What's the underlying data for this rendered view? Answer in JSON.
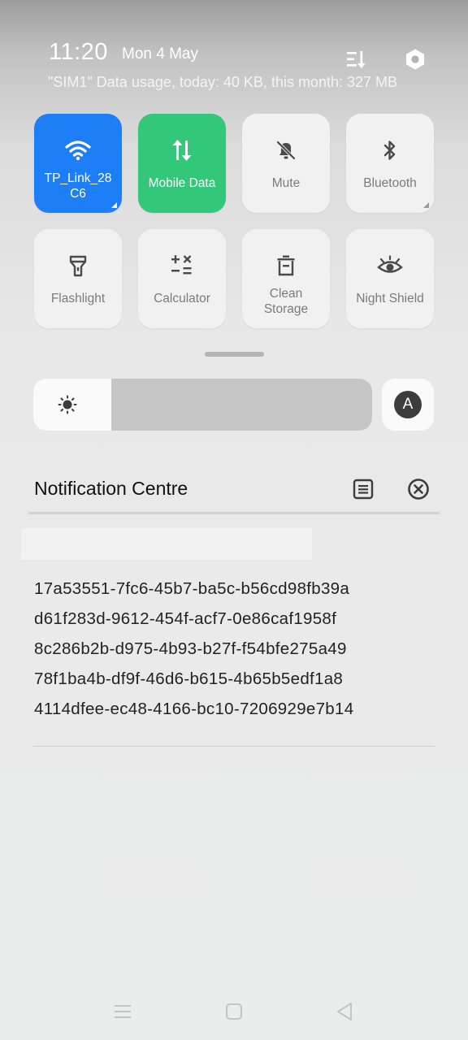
{
  "status": {
    "time": "11:20",
    "date": "Mon 4 May",
    "usage": "\"SIM1\" Data usage, today: 40 KB, this month: 327 MB"
  },
  "header_icons": [
    "sort-edit-icon",
    "settings-icon"
  ],
  "tiles": [
    {
      "label": "TP_Link_28\nC6",
      "icon": "wifi-icon",
      "state": "on",
      "color": "#1E7EF6"
    },
    {
      "label": "Mobile Data",
      "icon": "mobile-data-icon",
      "state": "on",
      "color": "#33C77A"
    },
    {
      "label": "Mute",
      "icon": "bell-off-icon",
      "state": "off"
    },
    {
      "label": "Bluetooth",
      "icon": "bluetooth-icon",
      "state": "off"
    },
    {
      "label": "Flashlight",
      "icon": "flashlight-icon",
      "state": "off"
    },
    {
      "label": "Calculator",
      "icon": "calculator-icon",
      "state": "off"
    },
    {
      "label": "Clean\nStorage",
      "icon": "trash-icon",
      "state": "off"
    },
    {
      "label": "Night Shield",
      "icon": "eye-icon",
      "state": "off"
    }
  ],
  "brightness": {
    "level": 0.23,
    "auto_label": "A"
  },
  "notification_centre": {
    "title": "Notification Centre",
    "entries": [
      "17a53551-7fc6-45b7-ba5c-b56cd98fb39a",
      "d61f283d-9612-454f-acf7-0e86caf1958f",
      "8c286b2b-d975-4b93-b27f-f54bfe275a49",
      "78f1ba4b-df9f-46d6-b615-4b65b5edf1a8",
      "4114dfee-ec48-4166-bc10-7206929e7b14"
    ]
  },
  "nav": [
    "menu-icon",
    "home-icon",
    "back-icon"
  ]
}
